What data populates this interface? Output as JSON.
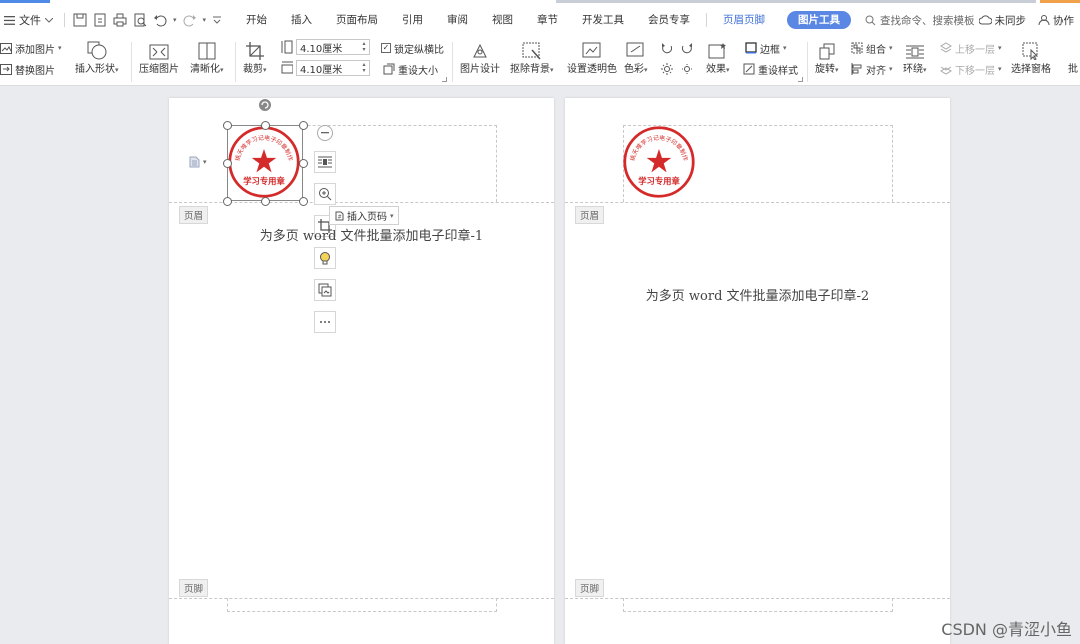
{
  "menubar": {
    "file_label": "文件",
    "tabs": [
      {
        "label": "开始"
      },
      {
        "label": "插入"
      },
      {
        "label": "页面布局"
      },
      {
        "label": "引用"
      },
      {
        "label": "审阅"
      },
      {
        "label": "视图"
      },
      {
        "label": "章节"
      },
      {
        "label": "开发工具"
      },
      {
        "label": "会员专享"
      },
      {
        "label": "页眉页脚"
      },
      {
        "label": "图片工具"
      }
    ],
    "search_placeholder": "查找命令、搜索模板",
    "sync_label": "未同步",
    "collab_label": "协作"
  },
  "ribbon": {
    "add_image": "添加图片",
    "replace_image": "替换图片",
    "insert_shape": "插入形状",
    "compress_image": "压缩图片",
    "sharpen": "清晰化",
    "crop": "裁剪",
    "height_value": "4.10厘米",
    "width_value": "4.10厘米",
    "lock_ratio": "锁定纵横比",
    "reset_size": "重设大小",
    "image_design": "图片设计",
    "remove_bg": "抠除背景",
    "set_transparent": "设置透明色",
    "color": "色彩",
    "effects": "效果",
    "border": "边框",
    "reset_style": "重设样式",
    "rotate": "旋转",
    "group": "组合",
    "align": "对齐",
    "wrap": "环绕",
    "bring_forward": "上移一层",
    "send_backward": "下移一层",
    "select_pane": "选择窗格",
    "batch": "批"
  },
  "page1": {
    "header_tag": "页眉",
    "footer_tag": "页脚",
    "body_text": "为多页 word 文件批量添加电子印章-1",
    "insert_page_number": "插入页码"
  },
  "page2": {
    "header_tag": "页眉",
    "footer_tag": "页脚",
    "body_text": "为多页 word 文件批量添加电子印章-2"
  },
  "seal": {
    "arc_text": "桃夭唯学习记电子印章制作",
    "bottom_text": "学习专用章",
    "color": "#d42a2a"
  },
  "watermark": "CSDN @青涩小鱼",
  "colors": {
    "accent": "#5a87e3",
    "seal_red": "#d42a2a"
  }
}
